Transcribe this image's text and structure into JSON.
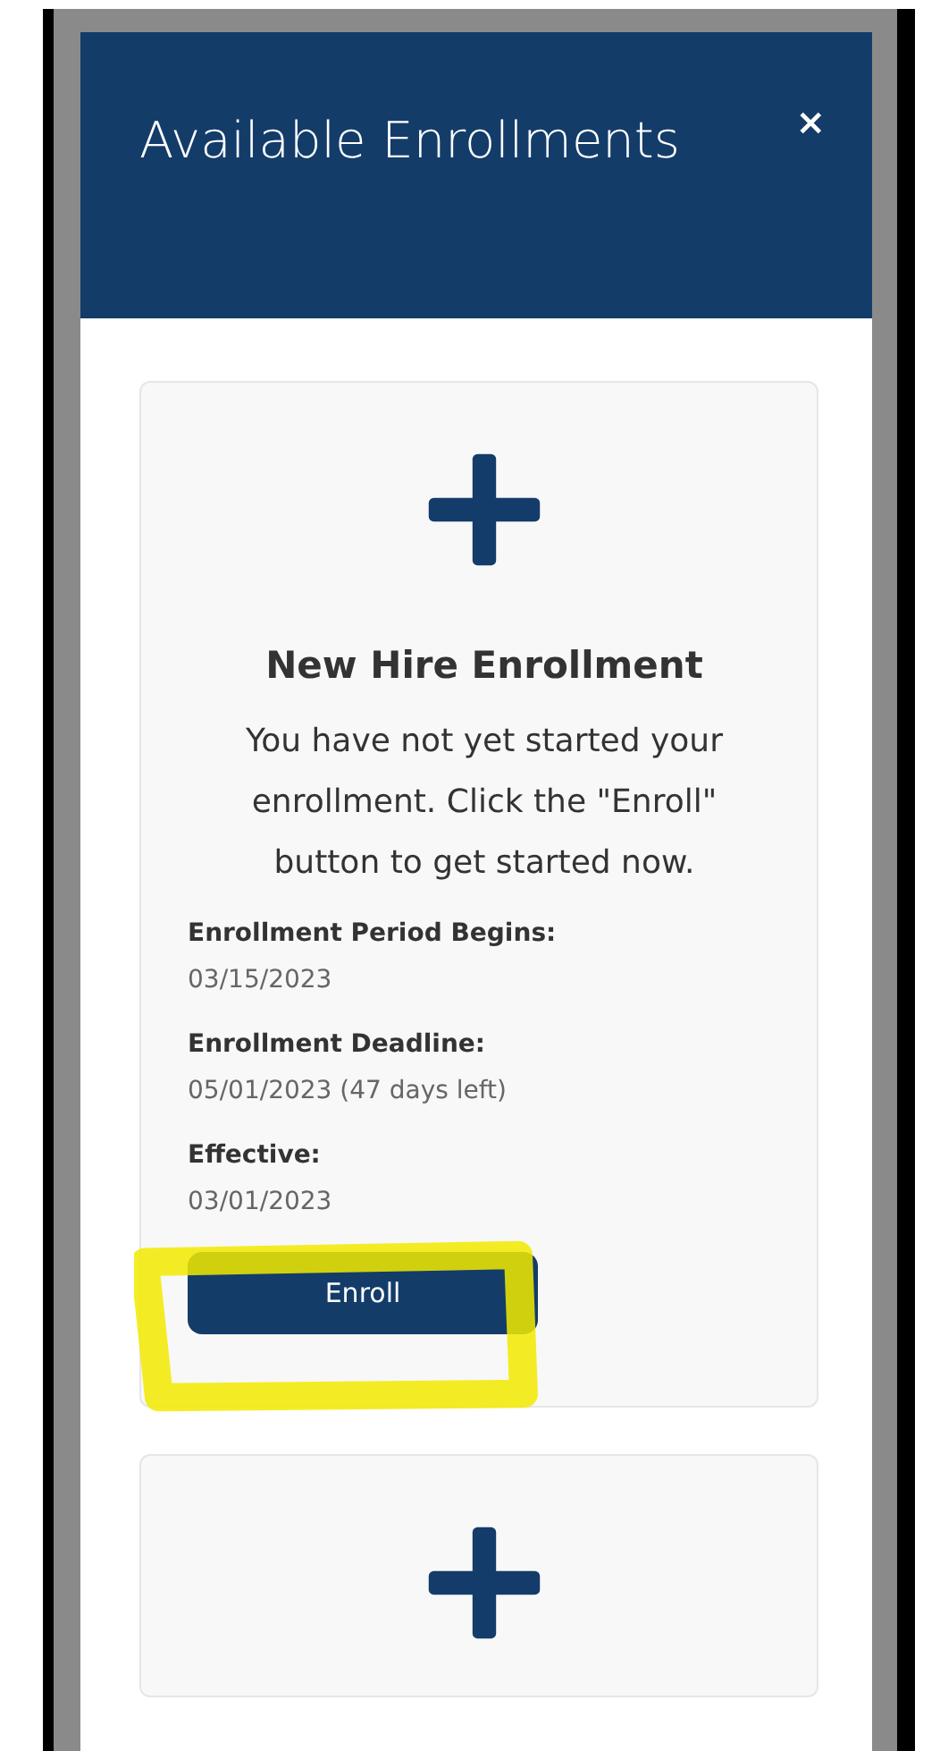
{
  "modal": {
    "title": "Available Enrollments",
    "close": "×"
  },
  "cards": [
    {
      "kind": "enrollment",
      "title": "New Hire Enrollment",
      "message": "You have not yet started your enrollment. Click the \"Enroll\" button to get started now.",
      "fields": [
        {
          "label": "Enrollment Period Begins:",
          "value": "03/15/2023"
        },
        {
          "label": "Enrollment Deadline:",
          "value": "05/01/2023 (47 days left)"
        },
        {
          "label": "Effective:",
          "value": "03/01/2023"
        }
      ],
      "button": "Enroll",
      "highlighted": true
    },
    {
      "kind": "icon-only"
    }
  ]
}
